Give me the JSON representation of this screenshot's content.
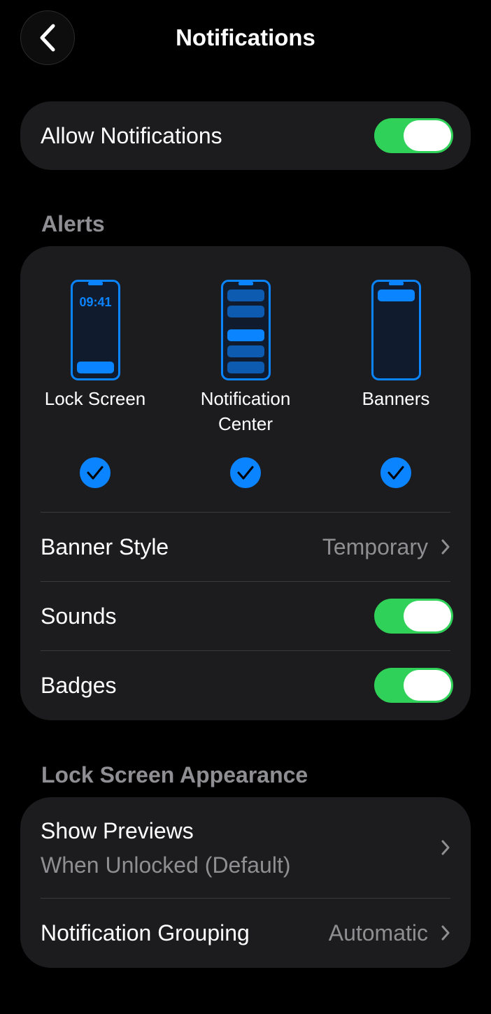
{
  "nav": {
    "title": "Notifications",
    "back_icon": "chevron-left-icon"
  },
  "allow_notifications": {
    "label": "Allow Notifications",
    "enabled": true
  },
  "alerts": {
    "header": "Alerts",
    "options": [
      {
        "label": "Lock Screen",
        "phone_time": "09:41",
        "selected": true
      },
      {
        "label": "Notification\nCenter",
        "selected": true
      },
      {
        "label": "Banners",
        "selected": true
      }
    ],
    "banner_style": {
      "label": "Banner Style",
      "value": "Temporary"
    },
    "sounds": {
      "label": "Sounds",
      "enabled": true
    },
    "badges": {
      "label": "Badges",
      "enabled": true
    }
  },
  "lock_screen_appearance": {
    "header": "Lock Screen Appearance",
    "show_previews": {
      "label": "Show Previews",
      "value": "When Unlocked (Default)"
    },
    "notification_grouping": {
      "label": "Notification Grouping",
      "value": "Automatic"
    }
  },
  "colors": {
    "background": "#000000",
    "card": "#1c1c1e",
    "toggle_on": "#30d158",
    "accent": "#0a84ff",
    "secondary_text": "#8e8e93",
    "separator": "#3a3a3c"
  }
}
